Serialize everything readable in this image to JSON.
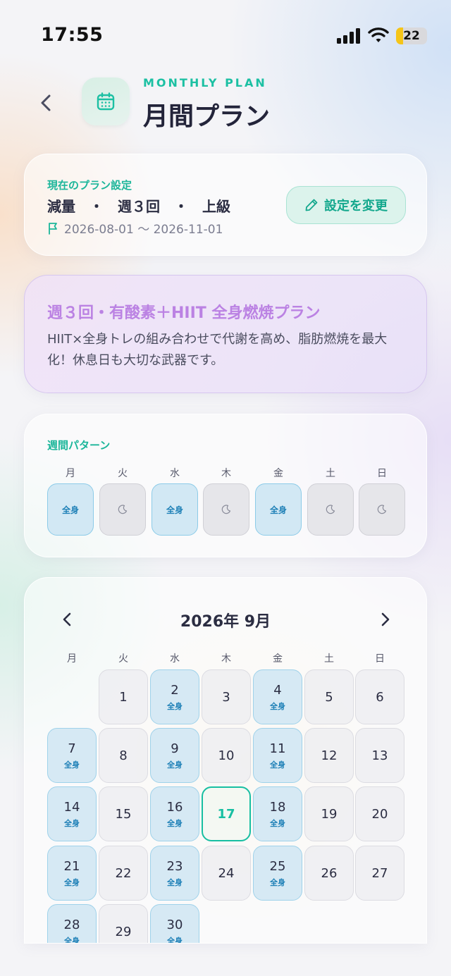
{
  "status": {
    "time": "17:55",
    "battery": "22",
    "battery_level": 0.22
  },
  "header": {
    "subtitle": "MONTHLY PLAN",
    "title": "月間プラン"
  },
  "plan": {
    "label": "現在のプラン設定",
    "summary": "減量　・　週３回　・　上級",
    "dates": "2026-08-01 〜 2026-11-01",
    "change_label": "設定を変更"
  },
  "description": {
    "title": "週３回・有酸素＋HIIT 全身燃焼プラン",
    "text": "HIIT×全身トレの組み合わせで代謝を高め、脂肪燃焼を最大化！休息日も大切な武器です。"
  },
  "weekly": {
    "label": "週間パターン",
    "days": [
      {
        "name": "月",
        "type": "train",
        "label": "全身"
      },
      {
        "name": "火",
        "type": "rest",
        "label": ""
      },
      {
        "name": "水",
        "type": "train",
        "label": "全身"
      },
      {
        "name": "木",
        "type": "rest",
        "label": ""
      },
      {
        "name": "金",
        "type": "train",
        "label": "全身"
      },
      {
        "name": "土",
        "type": "rest",
        "label": ""
      },
      {
        "name": "日",
        "type": "rest",
        "label": ""
      }
    ]
  },
  "calendar": {
    "month_label": "2026年 9月",
    "weekdays": [
      "月",
      "火",
      "水",
      "木",
      "金",
      "土",
      "日"
    ],
    "start_offset": 1,
    "today": 17,
    "train_label": "全身",
    "days": [
      {
        "n": "1",
        "train": false
      },
      {
        "n": "2",
        "train": true
      },
      {
        "n": "3",
        "train": false
      },
      {
        "n": "4",
        "train": true
      },
      {
        "n": "5",
        "train": false
      },
      {
        "n": "6",
        "train": false
      },
      {
        "n": "7",
        "train": true
      },
      {
        "n": "8",
        "train": false
      },
      {
        "n": "9",
        "train": true
      },
      {
        "n": "10",
        "train": false
      },
      {
        "n": "11",
        "train": true
      },
      {
        "n": "12",
        "train": false
      },
      {
        "n": "13",
        "train": false
      },
      {
        "n": "14",
        "train": true
      },
      {
        "n": "15",
        "train": false
      },
      {
        "n": "16",
        "train": true
      },
      {
        "n": "17",
        "train": false
      },
      {
        "n": "18",
        "train": true
      },
      {
        "n": "19",
        "train": false
      },
      {
        "n": "20",
        "train": false
      },
      {
        "n": "21",
        "train": true
      },
      {
        "n": "22",
        "train": false
      },
      {
        "n": "23",
        "train": true
      },
      {
        "n": "24",
        "train": false
      },
      {
        "n": "25",
        "train": true
      },
      {
        "n": "26",
        "train": false
      },
      {
        "n": "27",
        "train": false
      },
      {
        "n": "28",
        "train": true
      },
      {
        "n": "29",
        "train": false
      },
      {
        "n": "30",
        "train": true
      }
    ]
  },
  "colors": {
    "accent": "#1cc0a3",
    "train": "#1c7fb6",
    "purple": "#bb82e3"
  }
}
